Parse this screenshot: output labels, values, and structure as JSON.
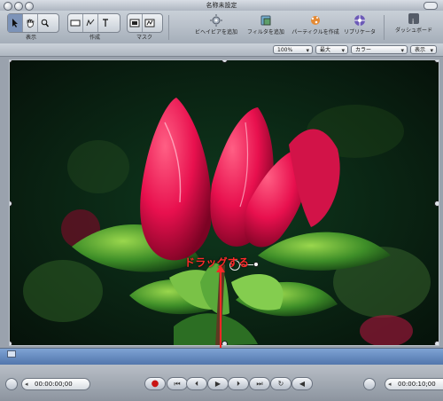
{
  "window": {
    "title": "名称未設定"
  },
  "toolbar": {
    "view_label": "表示",
    "create_label": "作成",
    "mask_label": "マスク",
    "add_behavior_label": "ビヘイビアを追加",
    "add_filter_label": "フィルタを追加",
    "make_particles_label": "パーティクルを作成",
    "replicator_label": "リプリケータ",
    "dashboard_label": "ダッシュボード",
    "icons": {
      "select": "select-arrow-icon",
      "hand": "hand-icon",
      "zoom": "zoom-icon",
      "rectangle": "rectangle-icon",
      "pen": "pen-icon",
      "text": "text-icon",
      "mask_rect": "mask-rectangle-icon",
      "mask_pen": "mask-pen-icon",
      "behavior": "behavior-gear-icon",
      "filter": "filter-icon",
      "particles": "particles-icon",
      "replicator": "replicator-icon",
      "dashboard": "dashboard-info-icon"
    }
  },
  "options": {
    "zoom": "100%",
    "quality": "最大",
    "color": "カラー",
    "view": "表示"
  },
  "canvas": {
    "annotation": "ドラッグする"
  },
  "transport": {
    "timecode_left": "00:00:00;00",
    "timecode_right": "00:00:10;00",
    "buttons": [
      "◀◀",
      "◀",
      "▶",
      "▶▶",
      "⏺",
      "◀▶",
      "◁",
      "▷"
    ]
  },
  "colors": {
    "accent_red": "#ff2a2a",
    "timeline_blue": "#6b8fc5"
  }
}
